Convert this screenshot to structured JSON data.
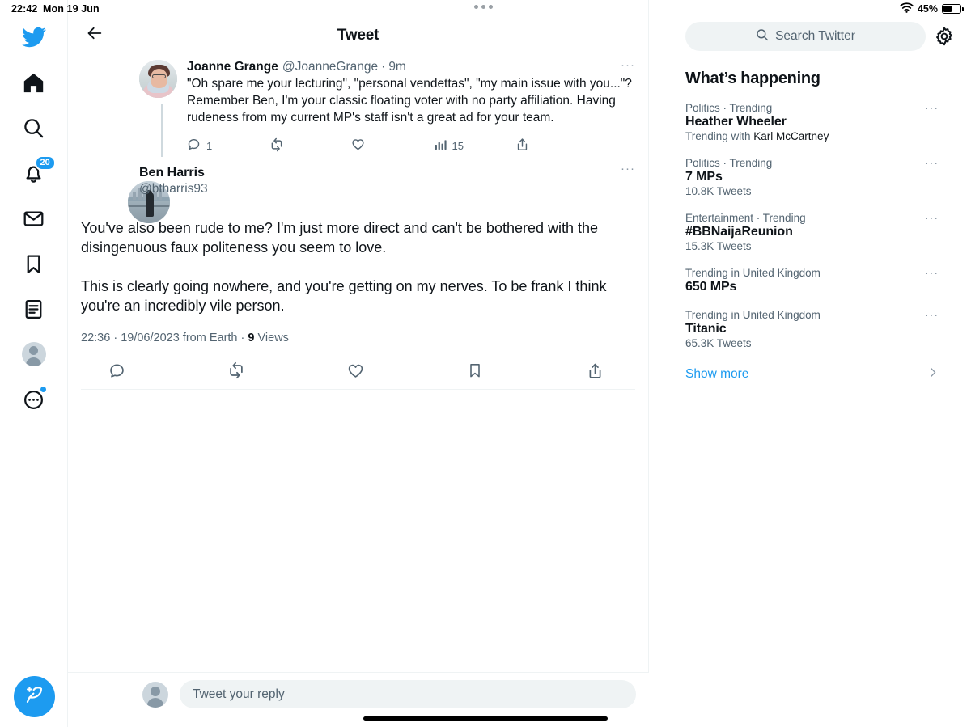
{
  "status_bar": {
    "time": "22:42",
    "date": "Mon 19 Jun",
    "battery_percent": "45%",
    "wifi_icon": "wifi-icon",
    "battery_icon": "battery-icon"
  },
  "left_nav": {
    "items": [
      {
        "name": "twitter-logo",
        "label": "Twitter"
      },
      {
        "name": "home",
        "label": "Home"
      },
      {
        "name": "explore",
        "label": "Explore"
      },
      {
        "name": "notifications",
        "label": "Notifications",
        "badge": "20"
      },
      {
        "name": "messages",
        "label": "Messages"
      },
      {
        "name": "bookmarks",
        "label": "Bookmarks"
      },
      {
        "name": "lists",
        "label": "Lists"
      },
      {
        "name": "profile",
        "label": "Profile"
      },
      {
        "name": "more",
        "label": "More"
      }
    ],
    "compose_label": "Tweet"
  },
  "center": {
    "header_title": "Tweet",
    "back_label": "Back",
    "quoted_tweet": {
      "display_name": "Joanne Grange",
      "handle": "@JoanneGrange",
      "separator": "·",
      "timestamp": "9m",
      "text": "\"Oh spare me your lecturing\", \"personal vendettas\", \"my main issue with you...\"? Remember Ben, I'm your classic floating voter with no party affiliation. Having rudeness from my current MP's staff isn't a great ad for your team.",
      "more_label": "···",
      "actions": {
        "reply_count": "1",
        "retweet_count": "",
        "like_count": "",
        "views_count": "15",
        "share_count": ""
      }
    },
    "main_tweet": {
      "display_name": "Ben Harris",
      "handle": "@btharris93",
      "text": "You've also been rude to me? I'm just more direct and can't be bothered with the disingenuous faux politeness you seem to love.\n\nThis is clearly going nowhere, and you're getting on my nerves. To be frank I think you're an incredibly vile person.",
      "more_label": "···",
      "meta_time": "22:36",
      "meta_sep1": "·",
      "meta_date": "19/06/2023 from Earth",
      "meta_sep2": "·",
      "meta_views_count": "9",
      "meta_views_label": "Views"
    },
    "reply_box": {
      "placeholder": "Tweet your reply",
      "value": ""
    }
  },
  "right": {
    "search": {
      "placeholder": "Search Twitter",
      "value": ""
    },
    "settings_label": "Settings",
    "whats_happening_title": "What’s happening",
    "trends": [
      {
        "category": "Politics · Trending",
        "name": "Heather Wheeler",
        "sub_prefix": "Trending with ",
        "sub_strong": "Karl McCartney",
        "sub_count": "",
        "more_label": "···"
      },
      {
        "category": "Politics · Trending",
        "name": "7 MPs",
        "sub_prefix": "",
        "sub_strong": "",
        "sub_count": "10.8K Tweets",
        "more_label": "···"
      },
      {
        "category": "Entertainment · Trending",
        "name": "#BBNaijaReunion",
        "sub_prefix": "",
        "sub_strong": "",
        "sub_count": "15.3K Tweets",
        "more_label": "···"
      },
      {
        "category": "Trending in United Kingdom",
        "name": "650 MPs",
        "sub_prefix": "",
        "sub_strong": "",
        "sub_count": "",
        "more_label": "···"
      },
      {
        "category": "Trending in United Kingdom",
        "name": "Titanic",
        "sub_prefix": "",
        "sub_strong": "",
        "sub_count": "65.3K Tweets",
        "more_label": "···"
      }
    ],
    "show_more_label": "Show more"
  },
  "colors": {
    "accent": "#1d9bf0",
    "text": "#0f1419",
    "muted": "#536471",
    "border": "#eff3f4"
  }
}
